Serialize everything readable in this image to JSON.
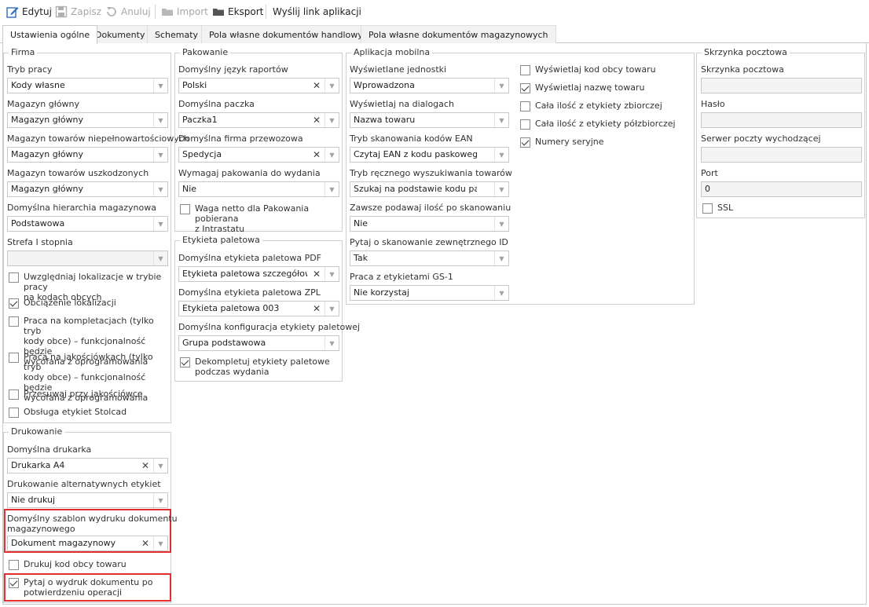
{
  "toolbar": {
    "edit": "Edytuj",
    "save": "Zapisz",
    "cancel": "Anuluj",
    "import": "Import",
    "export": "Eksport",
    "send_link": "Wyślij link aplikacji"
  },
  "tabs": [
    "Ustawienia ogólne",
    "Dokumenty",
    "Schematy",
    "Pola własne dokumentów handlowych",
    "Pola własne dokumentów magazynowych"
  ],
  "firma": {
    "title": "Firma",
    "tryb_pracy_label": "Tryb pracy",
    "tryb_pracy_value": "Kody własne",
    "magazyn_glowny_label": "Magazyn główny",
    "magazyn_glowny_value": "Magazyn główny",
    "magazyn_niepeln_label": "Magazyn towarów niepełnowartościowych",
    "magazyn_niepeln_value": "Magazyn główny",
    "magazyn_uszk_label": "Magazyn towarów uszkodzonych",
    "magazyn_uszk_value": "Magazyn główny",
    "hierarchia_label": "Domyślna hierarchia magazynowa",
    "hierarchia_value": "Podstawowa",
    "strefa_label": "Strefa I stopnia",
    "strefa_value": "",
    "chk_lokalizacje_l1": "Uwzględniaj lokalizacje w trybie pracy",
    "chk_lokalizacje_l2": "na kodach obcych",
    "chk_obciazenie": "Obciążenie lokalizacji",
    "chk_kompletacje_l1": "Praca na kompletacjach (tylko tryb",
    "chk_kompletacje_l2": "kody obce) – funkcjonalność będzie",
    "chk_kompletacje_l3": "wycofana z oprogramowania",
    "chk_jakosciowki_l1": "Praca na jakościówkach (tylko tryb",
    "chk_jakosciowki_l2": "kody obce) – funkcjonalność będzie",
    "chk_jakosciowki_l3": "wycofana z oprogramowania",
    "chk_przesuwaj": "Przesuwaj przy jakościówce",
    "chk_stolcad": "Obsługa etykiet Stolcad"
  },
  "drukowanie": {
    "title": "Drukowanie",
    "drukarka_label": "Domyślna drukarka",
    "drukarka_value": "Drukarka A4",
    "alternatywne_label": "Drukowanie alternatywnych etykiet",
    "alternatywne_value": "Nie drukuj",
    "szablon_label_l1": "Domyślny szablon wydruku dokumentu",
    "szablon_label_l2": "magazynowego",
    "szablon_value": "Dokument magazynowy",
    "chk_kod_obcy": "Drukuj kod obcy towaru",
    "chk_pytaj_l1": "Pytaj o wydruk dokumentu po",
    "chk_pytaj_l2": "potwierdzeniu operacji"
  },
  "pakowanie": {
    "title": "Pakowanie",
    "jezyk_label": "Domyślny język raportów",
    "jezyk_value": "Polski",
    "paczka_label": "Domyślna paczka",
    "paczka_value": "Paczka1",
    "firma_przew_label": "Domyślna firma przewozowa",
    "firma_przew_value": "Spedycja",
    "wymagaj_label": "Wymagaj pakowania do wydania",
    "wymagaj_value": "Nie",
    "chk_waga_l1": "Waga netto dla Pakowania pobierana",
    "chk_waga_l2": "z Intrastatu"
  },
  "etykieta": {
    "title": "Etykieta paletowa",
    "pdf_label": "Domyślna etykieta paletowa PDF",
    "pdf_value": "Etykieta paletowa szczegółowa ...",
    "zpl_label": "Domyślna etykieta paletowa ZPL",
    "zpl_value": "Etykieta paletowa 003",
    "konfig_label": "Domyślna konfiguracja etykiety paletowej",
    "konfig_value": "Grupa podstawowa",
    "chk_dekompletuj_l1": "Dekompletuj etykiety paletowe",
    "chk_dekompletuj_l2": "podczas wydania"
  },
  "aplikacja": {
    "title": "Aplikacja mobilna",
    "jednostki_label": "Wyświetlane jednostki",
    "jednostki_value": "Wprowadzona",
    "dialogi_label": "Wyświetlaj na dialogach",
    "dialogi_value": "Nazwa towaru",
    "ean_label": "Tryb skanowania kodów EAN",
    "ean_value": "Czytaj EAN z kodu paskowego",
    "reczne_label": "Tryb ręcznego wyszukiwania towarów",
    "reczne_value": "Szukaj na podstawie kodu paskowe...",
    "ilosc_label": "Zawsze podawaj ilość po skanowaniu",
    "ilosc_value": "Nie",
    "zewn_id_label": "Pytaj o skanowanie zewnętrznego ID",
    "zewn_id_value": "Tak",
    "gs1_label": "Praca z etykietami GS-1",
    "gs1_value": "Nie korzystaj",
    "chk_kod_obcy": "Wyświetlaj kod obcy towaru",
    "chk_nazwe": "Wyświetlaj nazwę towaru",
    "chk_zbiorczej": "Cała ilość z etykiety zbiorczej",
    "chk_polzbiorczej": "Cała ilość z etykiety półzbiorczej",
    "chk_numery": "Numery seryjne"
  },
  "skrzynka": {
    "title": "Skrzynka pocztowa",
    "skrzynka_label": "Skrzynka pocztowa",
    "skrzynka_value": "",
    "haslo_label": "Hasło",
    "haslo_value": "",
    "serwer_label": "Serwer poczty wychodzącej",
    "serwer_value": "",
    "port_label": "Port",
    "port_value": "0",
    "chk_ssl": "SSL"
  },
  "checkbox_states": {
    "lokalizacje": false,
    "obciazenie": true,
    "kompletacje": false,
    "jakosciowki": false,
    "przesuwaj": false,
    "stolcad": false,
    "kod_obcy_druk": false,
    "pytaj": true,
    "waga": false,
    "dekompletuj": true,
    "app_kod_obcy": false,
    "app_nazwe": true,
    "app_zbiorczej": false,
    "app_polzbiorczej": false,
    "app_numery": true,
    "ssl": false
  },
  "colors": {
    "highlight": "#e03030",
    "accent_icon": "#2b6fc2"
  }
}
